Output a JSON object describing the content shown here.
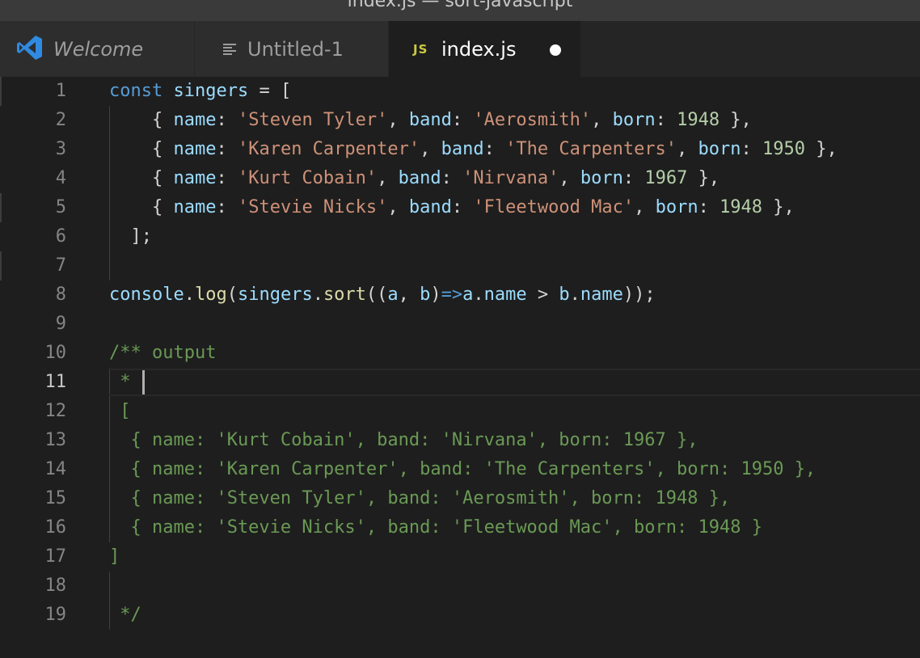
{
  "window": {
    "title": "index.js — sort-javascript"
  },
  "tabs": [
    {
      "label": "Welcome",
      "icon": "vscode-logo-icon",
      "active": false
    },
    {
      "label": "Untitled-1",
      "icon": "text-lines-icon",
      "active": false
    },
    {
      "label": "index.js",
      "icon": "js-file-icon",
      "icon_text": "JS",
      "active": true,
      "dirty": true
    }
  ],
  "editor": {
    "current_line": 11,
    "lines": [
      {
        "n": "1",
        "t": [
          [
            "kw",
            "const"
          ],
          [
            "pun",
            " "
          ],
          [
            "var",
            "singers"
          ],
          [
            "pun",
            " = ["
          ]
        ]
      },
      {
        "n": "2",
        "t": [
          [
            "pun",
            "    { "
          ],
          [
            "var",
            "name"
          ],
          [
            "pun",
            ": "
          ],
          [
            "str",
            "'Steven Tyler'"
          ],
          [
            "pun",
            ", "
          ],
          [
            "var",
            "band"
          ],
          [
            "pun",
            ": "
          ],
          [
            "str",
            "'Aerosmith'"
          ],
          [
            "pun",
            ", "
          ],
          [
            "var",
            "born"
          ],
          [
            "pun",
            ": "
          ],
          [
            "num",
            "1948"
          ],
          [
            "pun",
            " },"
          ]
        ]
      },
      {
        "n": "3",
        "t": [
          [
            "pun",
            "    { "
          ],
          [
            "var",
            "name"
          ],
          [
            "pun",
            ": "
          ],
          [
            "str",
            "'Karen Carpenter'"
          ],
          [
            "pun",
            ", "
          ],
          [
            "var",
            "band"
          ],
          [
            "pun",
            ": "
          ],
          [
            "str",
            "'The Carpenters'"
          ],
          [
            "pun",
            ", "
          ],
          [
            "var",
            "born"
          ],
          [
            "pun",
            ": "
          ],
          [
            "num",
            "1950"
          ],
          [
            "pun",
            " },"
          ]
        ]
      },
      {
        "n": "4",
        "t": [
          [
            "pun",
            "    { "
          ],
          [
            "var",
            "name"
          ],
          [
            "pun",
            ": "
          ],
          [
            "str",
            "'Kurt Cobain'"
          ],
          [
            "pun",
            ", "
          ],
          [
            "var",
            "band"
          ],
          [
            "pun",
            ": "
          ],
          [
            "str",
            "'Nirvana'"
          ],
          [
            "pun",
            ", "
          ],
          [
            "var",
            "born"
          ],
          [
            "pun",
            ": "
          ],
          [
            "num",
            "1967"
          ],
          [
            "pun",
            " },"
          ]
        ]
      },
      {
        "n": "5",
        "t": [
          [
            "pun",
            "    { "
          ],
          [
            "var",
            "name"
          ],
          [
            "pun",
            ": "
          ],
          [
            "str",
            "'Stevie Nicks'"
          ],
          [
            "pun",
            ", "
          ],
          [
            "var",
            "band"
          ],
          [
            "pun",
            ": "
          ],
          [
            "str",
            "'Fleetwood Mac'"
          ],
          [
            "pun",
            ", "
          ],
          [
            "var",
            "born"
          ],
          [
            "pun",
            ": "
          ],
          [
            "num",
            "1948"
          ],
          [
            "pun",
            " },"
          ]
        ]
      },
      {
        "n": "6",
        "t": [
          [
            "pun",
            "  ];"
          ]
        ]
      },
      {
        "n": "7",
        "t": []
      },
      {
        "n": "8",
        "t": [
          [
            "var",
            "console"
          ],
          [
            "pun",
            "."
          ],
          [
            "fn",
            "log"
          ],
          [
            "pun",
            "("
          ],
          [
            "var",
            "singers"
          ],
          [
            "pun",
            "."
          ],
          [
            "fn",
            "sort"
          ],
          [
            "pun",
            "(("
          ],
          [
            "var",
            "a"
          ],
          [
            "pun",
            ", "
          ],
          [
            "var",
            "b"
          ],
          [
            "pun",
            ")"
          ],
          [
            "arrow",
            "=>"
          ],
          [
            "var",
            "a"
          ],
          [
            "pun",
            "."
          ],
          [
            "var",
            "name"
          ],
          [
            "pun",
            " > "
          ],
          [
            "var",
            "b"
          ],
          [
            "pun",
            "."
          ],
          [
            "var",
            "name"
          ],
          [
            "pun",
            "));"
          ]
        ]
      },
      {
        "n": "9",
        "t": []
      },
      {
        "n": "10",
        "t": [
          [
            "cm",
            "/** output"
          ]
        ]
      },
      {
        "n": "11",
        "t": [
          [
            "cm",
            " * "
          ]
        ]
      },
      {
        "n": "12",
        "t": [
          [
            "cm",
            " ["
          ]
        ]
      },
      {
        "n": "13",
        "t": [
          [
            "cm",
            "  { name: 'Kurt Cobain', band: 'Nirvana', born: 1967 },"
          ]
        ]
      },
      {
        "n": "14",
        "t": [
          [
            "cm",
            "  { name: 'Karen Carpenter', band: 'The Carpenters', born: 1950 },"
          ]
        ]
      },
      {
        "n": "15",
        "t": [
          [
            "cm",
            "  { name: 'Steven Tyler', band: 'Aerosmith', born: 1948 },"
          ]
        ]
      },
      {
        "n": "16",
        "t": [
          [
            "cm",
            "  { name: 'Stevie Nicks', band: 'Fleetwood Mac', born: 1948 }"
          ]
        ]
      },
      {
        "n": "17",
        "t": [
          [
            "cm",
            "]"
          ]
        ]
      },
      {
        "n": "18",
        "t": []
      },
      {
        "n": "19",
        "t": [
          [
            "cm",
            " */"
          ]
        ]
      }
    ]
  }
}
